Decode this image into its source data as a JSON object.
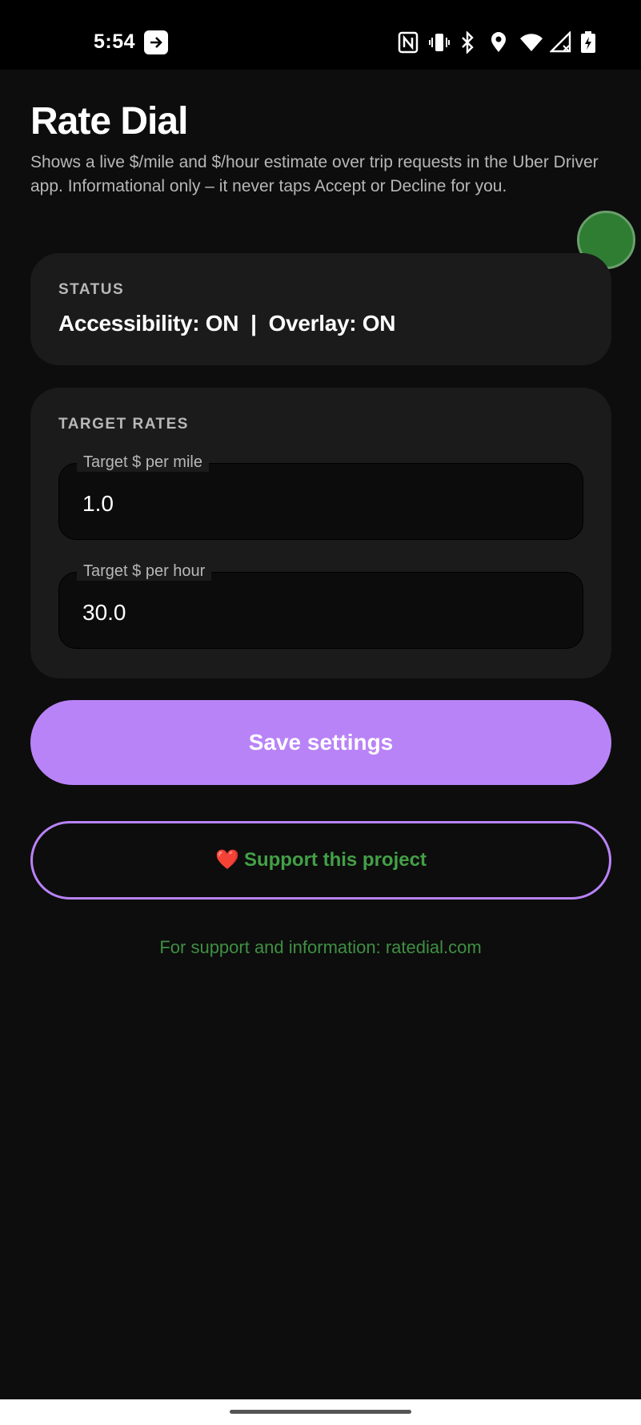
{
  "status_bar": {
    "time": "5:54",
    "icons": [
      "nfc-icon",
      "vibrate-icon",
      "bluetooth-icon",
      "location-icon",
      "wifi-icon",
      "signal-icon",
      "battery-icon"
    ]
  },
  "header": {
    "title": "Rate Dial",
    "description": "Shows a live $/mile and $/hour estimate over trip requests in the Uber Driver app. Informational only – it never taps Accept or Decline for you."
  },
  "status_card": {
    "heading": "STATUS",
    "status_text": "Accessibility: ON  |  Overlay: ON"
  },
  "targets_card": {
    "heading": "TARGET RATES",
    "per_mile": {
      "label": "Target $ per mile",
      "value": "1.0"
    },
    "per_hour": {
      "label": "Target $ per hour",
      "value": "30.0"
    }
  },
  "actions": {
    "save_label": "Save settings",
    "support_icon": "❤️",
    "support_label": "Support this project"
  },
  "footer": {
    "info": "For support and information: ratedial.com"
  },
  "colors": {
    "accent": "#b983f8",
    "support_text": "#43a047",
    "background": "#0d0d0d",
    "card": "#1b1b1b",
    "dot": "#2e7d32"
  }
}
